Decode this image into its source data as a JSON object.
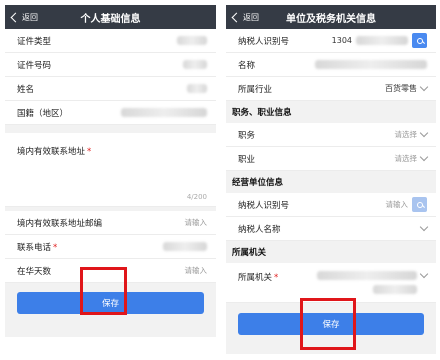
{
  "left": {
    "nav": {
      "back_label": "返回",
      "title": "个人基础信息"
    },
    "rows": [
      {
        "label": "证件类型"
      },
      {
        "label": "证件号码"
      },
      {
        "label": "姓名"
      },
      {
        "label": "国籍（地区）"
      }
    ],
    "address": {
      "label": "境内有效联系地址",
      "required_mark": "*",
      "counter": "4/200"
    },
    "postcode": {
      "label": "境内有效联系地址邮编",
      "placeholder": "请输入"
    },
    "phone": {
      "label": "联系电话",
      "required_mark": "*"
    },
    "days": {
      "label": "在华天数",
      "placeholder": "请输入"
    },
    "save_label": "保存"
  },
  "right": {
    "nav": {
      "back_label": "返回",
      "title": "单位及税务机关信息"
    },
    "taxpayer_id": {
      "label": "纳税人识别号",
      "value": "1304"
    },
    "name": {
      "label": "名称"
    },
    "industry": {
      "label": "所属行业",
      "value": "百货零售"
    },
    "section_job": "职务、职业信息",
    "position": {
      "label": "职务",
      "placeholder": "请选择"
    },
    "occupation": {
      "label": "职业",
      "placeholder": "请选择"
    },
    "section_employer": "经营单位信息",
    "biz_taxpayer_id": {
      "label": "纳税人识别号",
      "placeholder": "请输入"
    },
    "biz_taxpayer_name": {
      "label": "纳税人名称"
    },
    "section_authority": "所属机关",
    "authority": {
      "label": "所属机关",
      "required_mark": "*"
    },
    "save_label": "保存"
  },
  "colors": {
    "navbar": "#353b45",
    "button": "#3d7fe8",
    "highlight": "#e0161a",
    "required": "#e02020"
  }
}
